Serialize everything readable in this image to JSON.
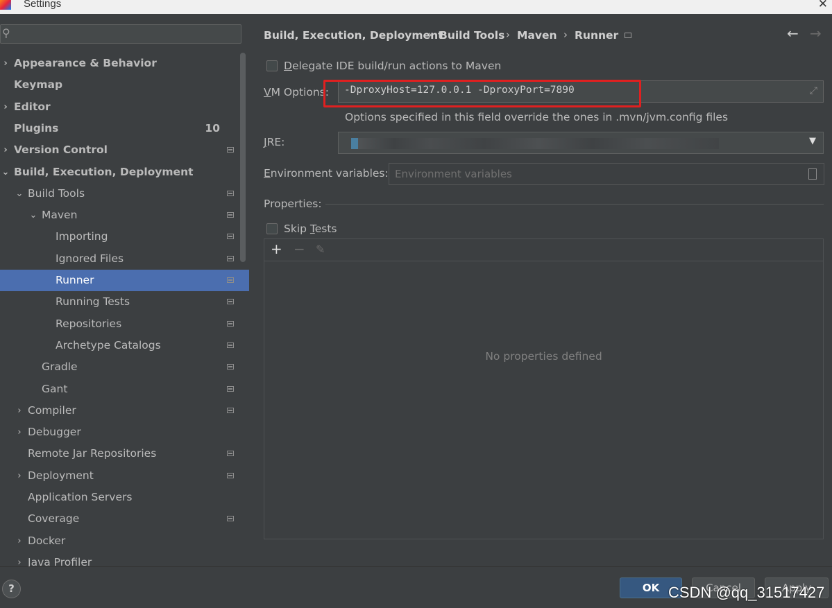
{
  "window": {
    "title": "Settings",
    "close": "✕"
  },
  "search": {
    "placeholder": "",
    "icon": "search-icon"
  },
  "tree": [
    {
      "label": "Appearance & Behavior",
      "level": 0,
      "arrow": "›",
      "bold": true
    },
    {
      "label": "Keymap",
      "level": 0,
      "arrow": "",
      "bold": true
    },
    {
      "label": "Editor",
      "level": 0,
      "arrow": "›",
      "bold": true
    },
    {
      "label": "Plugins",
      "level": 0,
      "arrow": "",
      "bold": true,
      "badge": "10"
    },
    {
      "label": "Version Control",
      "level": 0,
      "arrow": "›",
      "bold": true,
      "project": true
    },
    {
      "label": "Build, Execution, Deployment",
      "level": 0,
      "arrow": "⌄",
      "bold": true
    },
    {
      "label": "Build Tools",
      "level": 1,
      "arrow": "⌄",
      "project": true
    },
    {
      "label": "Maven",
      "level": 2,
      "arrow": "⌄",
      "project": true
    },
    {
      "label": "Importing",
      "level": 3,
      "arrow": "",
      "project": true
    },
    {
      "label": "Ignored Files",
      "level": 3,
      "arrow": "",
      "project": true
    },
    {
      "label": "Runner",
      "level": 3,
      "arrow": "",
      "project": true,
      "selected": true
    },
    {
      "label": "Running Tests",
      "level": 3,
      "arrow": "",
      "project": true
    },
    {
      "label": "Repositories",
      "level": 3,
      "arrow": "",
      "project": true
    },
    {
      "label": "Archetype Catalogs",
      "level": 3,
      "arrow": "",
      "project": true
    },
    {
      "label": "Gradle",
      "level": 2,
      "arrow": "",
      "project": true
    },
    {
      "label": "Gant",
      "level": 2,
      "arrow": "",
      "project": true
    },
    {
      "label": "Compiler",
      "level": 1,
      "arrow": "›",
      "project": true
    },
    {
      "label": "Debugger",
      "level": 1,
      "arrow": "›"
    },
    {
      "label": "Remote Jar Repositories",
      "level": 1,
      "arrow": "",
      "project": true
    },
    {
      "label": "Deployment",
      "level": 1,
      "arrow": "›",
      "project": true
    },
    {
      "label": "Application Servers",
      "level": 1,
      "arrow": ""
    },
    {
      "label": "Coverage",
      "level": 1,
      "arrow": "",
      "project": true
    },
    {
      "label": "Docker",
      "level": 1,
      "arrow": "›"
    },
    {
      "label": "Java Profiler",
      "level": 1,
      "arrow": "›"
    }
  ],
  "breadcrumb": [
    "Build, Execution, Deployment",
    "Build Tools",
    "Maven",
    "Runner"
  ],
  "breadcrumb_sep": "›",
  "nav": {
    "back": "←",
    "forward": "→"
  },
  "delegate": {
    "prefix": "D",
    "rest": "elegate IDE build/run actions to Maven",
    "checked": false
  },
  "vm_options": {
    "label_u": "V",
    "label_rest": "M Options:",
    "value": "-DproxyHost=127.0.0.1 -DproxyPort=7890",
    "expand": "⤢"
  },
  "vm_hint": "Options specified in this field override the ones in .mvn/jvm.config files",
  "jre": {
    "label_u": "J",
    "label_rest": "RE:",
    "dropdown": "▼"
  },
  "env": {
    "label_u": "E",
    "label_rest": "nvironment variables:",
    "placeholder": "Environment variables"
  },
  "properties": {
    "label": "Properties:"
  },
  "skip_tests": {
    "prefix": "Skip ",
    "u": "T",
    "rest": "ests",
    "checked": false
  },
  "table_toolbar": {
    "add": "+",
    "remove": "−",
    "edit": "✎"
  },
  "table_empty": "No properties defined",
  "buttons": {
    "help": "?",
    "ok": "OK",
    "cancel": "Cancel",
    "apply": "Apply"
  },
  "watermark": "CSDN @qq_31517427",
  "colors": {
    "selection": "#4b6eaf",
    "highlight_box": "#e02020",
    "ok_button": "#365880"
  }
}
